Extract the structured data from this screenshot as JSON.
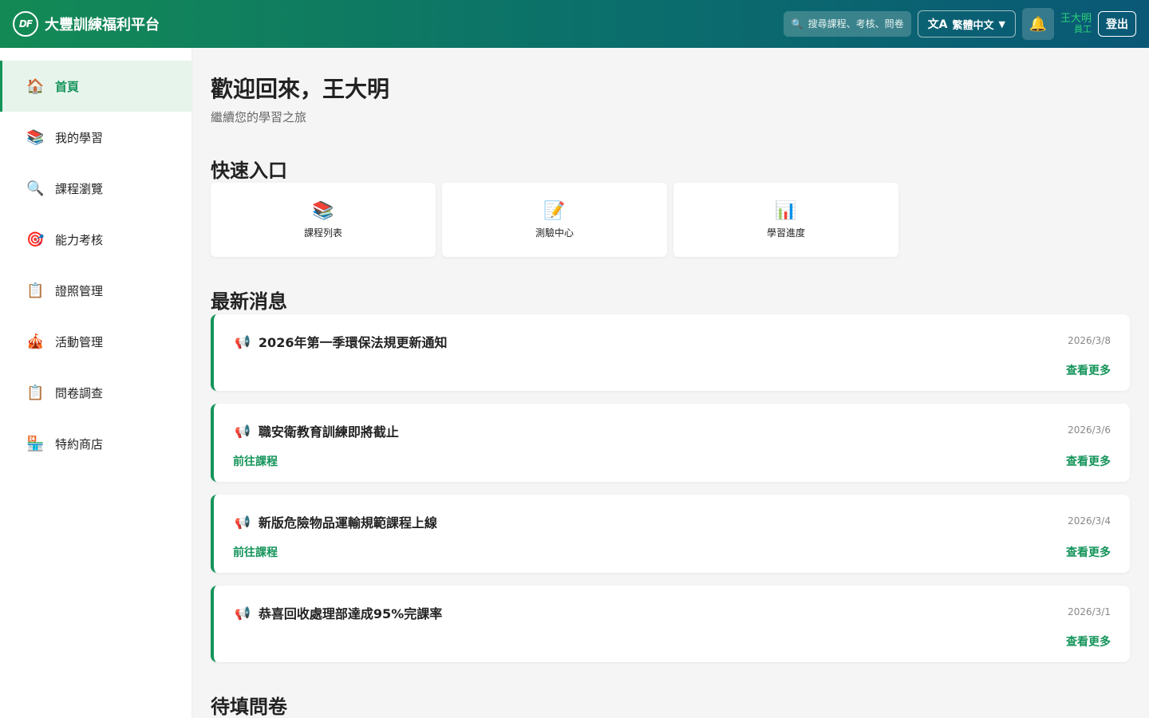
{
  "header": {
    "logo_text": "DF",
    "brand": "大豐訓練福利平台",
    "search_placeholder": "搜尋課程、考核、問卷…",
    "language": "繁體中文",
    "user_name": "王大明",
    "user_role": "員工",
    "logout": "登出"
  },
  "sidebar": {
    "items": [
      {
        "label": "首頁",
        "icon": "home-icon",
        "glyph": "🏠",
        "active": true
      },
      {
        "label": "我的學習",
        "icon": "books-icon",
        "glyph": "📚"
      },
      {
        "label": "課程瀏覽",
        "icon": "search-icon",
        "glyph": "🔍"
      },
      {
        "label": "能力考核",
        "icon": "target-icon",
        "glyph": "🎯"
      },
      {
        "label": "證照管理",
        "icon": "clipboard-icon",
        "glyph": "📋"
      },
      {
        "label": "活動管理",
        "icon": "tent-icon",
        "glyph": "🎪"
      },
      {
        "label": "問卷調查",
        "icon": "clipboard-icon",
        "glyph": "📋"
      },
      {
        "label": "特約商店",
        "icon": "store-icon",
        "glyph": "🏪"
      }
    ]
  },
  "main": {
    "welcome": "歡迎回來，王大明",
    "subtitle": "繼續您的學習之旅",
    "quick_title": "快速入口",
    "quick": [
      {
        "label": "課程列表",
        "icon": "books-icon",
        "glyph": "📚"
      },
      {
        "label": "測驗中心",
        "icon": "memo-icon",
        "glyph": "📝"
      },
      {
        "label": "學習進度",
        "icon": "bar-chart-icon",
        "glyph": "📊"
      }
    ],
    "news_title": "最新消息",
    "news": [
      {
        "title": "2026年第一季環保法規更新通知",
        "date": "2026/3/8",
        "goto": "",
        "more": "查看更多"
      },
      {
        "title": "職安衛教育訓練即將截止",
        "date": "2026/3/6",
        "goto": "前往課程",
        "more": "查看更多"
      },
      {
        "title": "新版危險物品運輸規範課程上線",
        "date": "2026/3/4",
        "goto": "前往課程",
        "more": "查看更多"
      },
      {
        "title": "恭喜回收處理部達成95%完課率",
        "date": "2026/3/1",
        "goto": "",
        "more": "查看更多"
      }
    ],
    "survey_title": "待填問卷"
  },
  "colors": {
    "accent": "#15945a",
    "header_start": "#138a55",
    "header_end": "#0a5876"
  }
}
